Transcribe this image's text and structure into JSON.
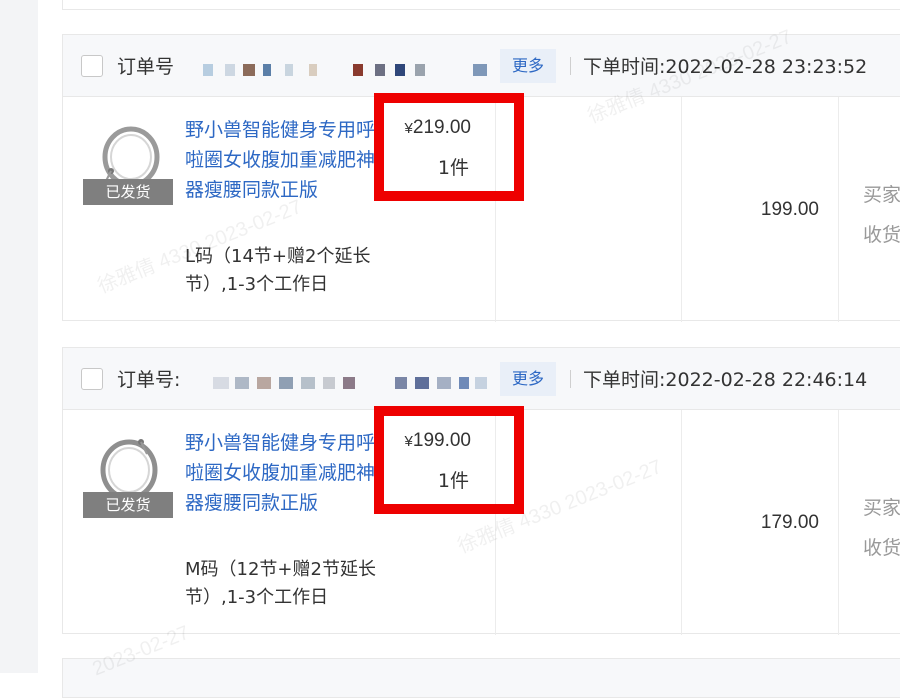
{
  "orders": [
    {
      "order_label": "订单号",
      "more_label": "更多",
      "time_label": "下单时间:",
      "time_value": "2022-02-28 23:23:52",
      "status_badge": "已发货",
      "product_title": "野小兽智能健身专用呼啦圈女收腹加重减肥神器瘦腰同款正版",
      "spec": "L码（14节+赠2个延长节）,1-3个工作日",
      "unit_price": "219.00",
      "currency_symbol": "¥",
      "quantity": "1件",
      "paid_amount": "199.00",
      "side_text_1": "买家",
      "side_text_2": "收货"
    },
    {
      "order_label": "订单号:",
      "more_label": "更多",
      "time_label": "下单时间:",
      "time_value": "2022-02-28 22:46:14",
      "status_badge": "已发货",
      "product_title": "野小兽智能健身专用呼啦圈女收腹加重减肥神器瘦腰同款正版",
      "spec": "M码（12节+赠2节延长节）,1-3个工作日",
      "unit_price": "199.00",
      "currency_symbol": "¥",
      "quantity": "1件",
      "paid_amount": "179.00",
      "side_text_1": "买家",
      "side_text_2": "收货"
    }
  ],
  "watermark_text": "徐雅倩 4330 2023-02-27",
  "watermark_short": "2023-02-27",
  "colors": {
    "link": "#2d68c4",
    "highlight": "#ee0000",
    "badge": "#7f7f7f"
  }
}
